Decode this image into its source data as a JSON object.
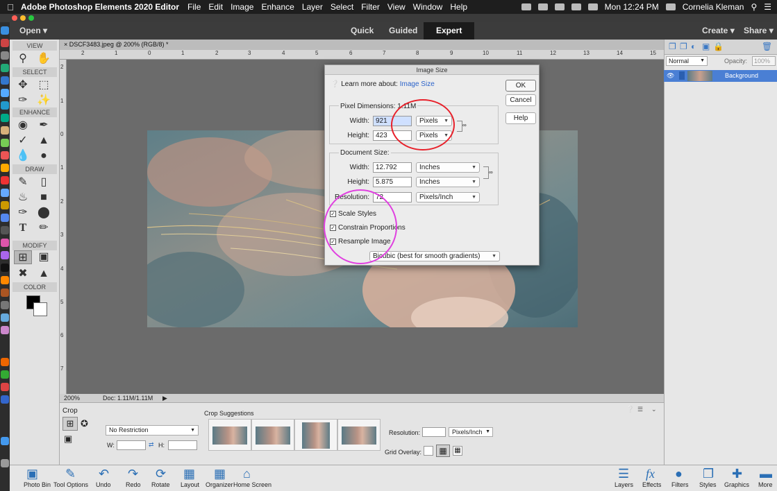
{
  "menubar": {
    "app": "Adobe Photoshop Elements 2020 Editor",
    "items": [
      "File",
      "Edit",
      "Image",
      "Enhance",
      "Layer",
      "Select",
      "Filter",
      "View",
      "Window",
      "Help"
    ],
    "clock": "Mon 12:24 PM",
    "user": "Cornelia Kleman"
  },
  "topbar": {
    "open": "Open",
    "modes": [
      "Quick",
      "Guided",
      "Expert"
    ],
    "active_mode": "Expert",
    "create": "Create",
    "share": "Share"
  },
  "tools": {
    "sections": [
      "VIEW",
      "SELECT",
      "ENHANCE",
      "DRAW",
      "MODIFY",
      "COLOR"
    ]
  },
  "document": {
    "tab": "DSCF3483.jpeg @ 200% (RGB/8) *",
    "ruler_h": [
      "2",
      "1",
      "0",
      "1",
      "2",
      "3",
      "4",
      "5",
      "6",
      "7",
      "8",
      "9",
      "10",
      "11",
      "12",
      "13",
      "14",
      "15"
    ],
    "ruler_v": [
      "2",
      "1",
      "0",
      "1",
      "2",
      "3",
      "4",
      "5",
      "6",
      "7"
    ],
    "zoom": "200%",
    "doc_info": "Doc: 1.11M/1.11M"
  },
  "layers": {
    "mode": "Normal",
    "opacity_label": "Opacity:",
    "opacity": "100%",
    "layer_name": "Background"
  },
  "dialog": {
    "title": "Image Size",
    "learn_prefix": "Learn more about:",
    "learn_link": "Image Size",
    "ok": "OK",
    "cancel": "Cancel",
    "help": "Help",
    "pixel_dims_label": "Pixel Dimensions: 1.11M",
    "width_label": "Width:",
    "height_label": "Height:",
    "pixel_width": "921",
    "pixel_height": "423",
    "pixel_unit_w": "Pixels",
    "pixel_unit_h": "Pixels",
    "doc_size_label": "Document Size:",
    "doc_width": "12.792",
    "doc_height": "5.875",
    "doc_unit_w": "Inches",
    "doc_unit_h": "Inches",
    "resolution_label": "Resolution:",
    "resolution": "72",
    "resolution_unit": "Pixels/Inch",
    "scale_styles": "Scale Styles",
    "constrain": "Constrain Proportions",
    "resample": "Resample Image",
    "resample_method": "Bicubic (best for smooth gradients)",
    "checks": {
      "scale_styles": true,
      "constrain": true,
      "resample": true
    }
  },
  "options": {
    "tool": "Crop",
    "preset": "No Restriction",
    "w_label": "W:",
    "h_label": "H:",
    "suggestions_label": "Crop Suggestions",
    "resolution_label": "Resolution:",
    "resolution_unit": "Pixels/Inch",
    "grid_overlay": "Grid Overlay:"
  },
  "bottombar": {
    "left": [
      "Photo Bin",
      "Tool Options",
      "Undo",
      "Redo",
      "Rotate",
      "Layout",
      "Organizer",
      "Home Screen"
    ],
    "right": [
      "Layers",
      "Effects",
      "Filters",
      "Styles",
      "Graphics",
      "More"
    ]
  },
  "colors": {
    "menubar": "#1e1e1e",
    "accent": "#4a7fd4",
    "annotation_red": "#e8202a",
    "annotation_magenta": "#e040e0"
  }
}
